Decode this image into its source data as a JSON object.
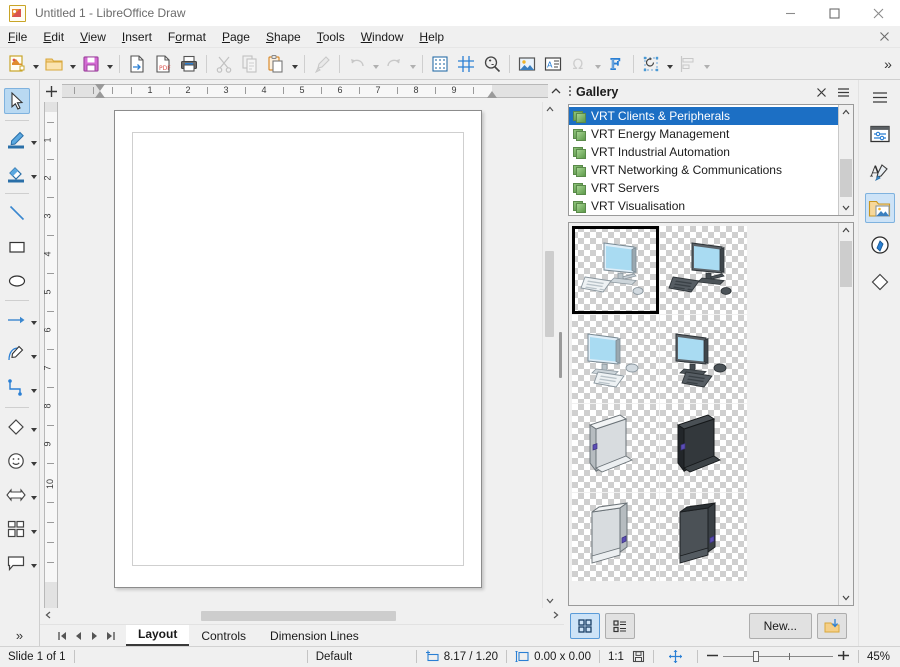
{
  "window": {
    "title": "Untitled 1 - LibreOffice Draw",
    "app_icon": "draw-document-icon",
    "minimize": "minimize-icon",
    "maximize": "maximize-icon",
    "close": "close-icon"
  },
  "menubar": {
    "items": [
      {
        "label": "File",
        "mnemonic": "F"
      },
      {
        "label": "Edit",
        "mnemonic": "E"
      },
      {
        "label": "View",
        "mnemonic": "V"
      },
      {
        "label": "Insert",
        "mnemonic": "I"
      },
      {
        "label": "Format",
        "mnemonic": "o"
      },
      {
        "label": "Page",
        "mnemonic": "P"
      },
      {
        "label": "Shape",
        "mnemonic": "S"
      },
      {
        "label": "Tools",
        "mnemonic": "T"
      },
      {
        "label": "Window",
        "mnemonic": "W"
      },
      {
        "label": "Help",
        "mnemonic": "H"
      }
    ],
    "document_close": "close-document-icon"
  },
  "toolbar": {
    "items": [
      {
        "name": "new-document",
        "label": "New",
        "icon": "new-document-icon",
        "dropdown": true,
        "disabled": false
      },
      {
        "name": "open-document",
        "label": "Open",
        "icon": "open-folder-icon",
        "dropdown": true,
        "disabled": false
      },
      {
        "name": "save-document",
        "label": "Save",
        "icon": "save-floppy-icon",
        "dropdown": true,
        "disabled": false
      },
      {
        "name": "export",
        "label": "Export",
        "icon": "export-icon",
        "dropdown": false,
        "disabled": false
      },
      {
        "name": "export-pdf",
        "label": "Export as PDF",
        "icon": "pdf-icon",
        "dropdown": false,
        "disabled": false
      },
      {
        "name": "print",
        "label": "Print",
        "icon": "printer-icon",
        "dropdown": false,
        "disabled": false
      },
      {
        "name": "cut",
        "label": "Cut",
        "icon": "scissors-icon",
        "dropdown": false,
        "disabled": true
      },
      {
        "name": "copy",
        "label": "Copy",
        "icon": "copy-icon",
        "dropdown": false,
        "disabled": true
      },
      {
        "name": "paste",
        "label": "Paste",
        "icon": "clipboard-paste-icon",
        "dropdown": true,
        "disabled": false
      },
      {
        "name": "clone-formatting",
        "label": "Clone Formatting",
        "icon": "paintbrush-clone-icon",
        "dropdown": false,
        "disabled": true
      },
      {
        "name": "undo",
        "label": "Undo",
        "icon": "undo-arrow-icon",
        "dropdown": true,
        "disabled": true
      },
      {
        "name": "redo",
        "label": "Redo",
        "icon": "redo-arrow-icon",
        "dropdown": true,
        "disabled": true
      },
      {
        "name": "display-grid",
        "label": "Display Grid",
        "icon": "grid-dots-icon",
        "dropdown": false,
        "disabled": false
      },
      {
        "name": "snap-to-grid",
        "label": "Snap to Grid",
        "icon": "snap-grid-icon",
        "dropdown": false,
        "disabled": false
      },
      {
        "name": "zoom",
        "label": "Zoom",
        "icon": "magnifier-zoom-icon",
        "dropdown": false,
        "disabled": false
      },
      {
        "name": "insert-image",
        "label": "Insert Image",
        "icon": "picture-icon",
        "dropdown": false,
        "disabled": false
      },
      {
        "name": "insert-text-box",
        "label": "Insert Text Box",
        "icon": "text-box-icon",
        "dropdown": false,
        "disabled": false
      },
      {
        "name": "special-character",
        "label": "Special Character",
        "icon": "omega-icon",
        "dropdown": true,
        "disabled": true
      },
      {
        "name": "fontwork",
        "label": "Fontwork",
        "icon": "fontwork-f-icon",
        "dropdown": false,
        "disabled": false
      },
      {
        "name": "transformations",
        "label": "Transformations",
        "icon": "rotate-object-icon",
        "dropdown": true,
        "disabled": false
      },
      {
        "name": "align-objects",
        "label": "Align Objects",
        "icon": "align-left-objects-icon",
        "dropdown": true,
        "disabled": true
      }
    ],
    "overflow": "toolbar-overflow-icon"
  },
  "left_tools": {
    "items": [
      {
        "name": "select",
        "label": "Select",
        "icon": "cursor-arrow-icon",
        "dropdown": false,
        "active": true
      },
      {
        "name": "line-color",
        "label": "Line Color",
        "icon": "line-color-icon",
        "dropdown": true,
        "active": false
      },
      {
        "name": "fill-color",
        "label": "Fill Color",
        "icon": "fill-color-icon",
        "dropdown": true,
        "active": false
      },
      {
        "name": "insert-line",
        "label": "Insert Line",
        "icon": "diagonal-line-icon",
        "dropdown": false,
        "active": false
      },
      {
        "name": "rectangle",
        "label": "Rectangle",
        "icon": "rectangle-icon",
        "dropdown": false,
        "active": false
      },
      {
        "name": "ellipse",
        "label": "Ellipse",
        "icon": "ellipse-icon",
        "dropdown": false,
        "active": false
      },
      {
        "name": "lines-arrows",
        "label": "Lines and Arrows",
        "icon": "arrow-line-icon",
        "dropdown": true,
        "active": false
      },
      {
        "name": "curves-polygons",
        "label": "Curves and Polygons",
        "icon": "curve-pen-icon",
        "dropdown": true,
        "active": false
      },
      {
        "name": "connectors",
        "label": "Connectors",
        "icon": "connector-icon",
        "dropdown": true,
        "active": false
      },
      {
        "name": "basic-shapes",
        "label": "Basic Shapes",
        "icon": "diamond-shape-icon",
        "dropdown": true,
        "active": false
      },
      {
        "name": "symbol-shapes",
        "label": "Symbol Shapes",
        "icon": "smiley-face-icon",
        "dropdown": true,
        "active": false
      },
      {
        "name": "block-arrows",
        "label": "Block Arrows",
        "icon": "double-arrow-icon",
        "dropdown": true,
        "active": false
      },
      {
        "name": "flowchart",
        "label": "Flowchart",
        "icon": "flowchart-grid-icon",
        "dropdown": true,
        "active": false
      },
      {
        "name": "callouts",
        "label": "Callout Shapes",
        "icon": "speech-bubble-icon",
        "dropdown": true,
        "active": false
      }
    ],
    "overflow": "left-toolbar-overflow-icon"
  },
  "rulers": {
    "horizontal": {
      "unit": "inch",
      "numbers": [
        1,
        2,
        3,
        4,
        5,
        6,
        7,
        8,
        9
      ],
      "corner_icon": "ruler-origin-icon",
      "collapse_icon": "chevron-up-icon"
    },
    "vertical": {
      "unit": "inch",
      "numbers": [
        1,
        2,
        3,
        4,
        5,
        6,
        7,
        8,
        9,
        10
      ]
    }
  },
  "canvas": {
    "page_name": "blank-drawing-page",
    "vscrollbar": "vertical-scrollbar",
    "hscrollbar": "horizontal-scrollbar"
  },
  "layer_tabs": {
    "nav": [
      {
        "name": "first-page",
        "icon": "first-page-icon"
      },
      {
        "name": "previous-page",
        "icon": "previous-page-icon"
      },
      {
        "name": "next-page",
        "icon": "next-page-icon"
      },
      {
        "name": "last-page",
        "icon": "last-page-icon"
      }
    ],
    "tabs": [
      {
        "label": "Layout",
        "active": true
      },
      {
        "label": "Controls",
        "active": false
      },
      {
        "label": "Dimension Lines",
        "active": false
      }
    ]
  },
  "gallery": {
    "title": "Gallery",
    "close_icon": "close-icon",
    "menu_icon": "hamburger-menu-icon",
    "grip_icon": "panel-grip-icon",
    "themes": [
      {
        "label": "VRT Clients & Peripherals",
        "selected": true
      },
      {
        "label": "VRT Energy Management",
        "selected": false
      },
      {
        "label": "VRT Industrial Automation",
        "selected": false
      },
      {
        "label": "VRT Networking & Communications",
        "selected": false
      },
      {
        "label": "VRT Servers",
        "selected": false
      },
      {
        "label": "VRT Visualisation",
        "selected": false
      }
    ],
    "theme_scroll_up": "scroll-up-icon",
    "theme_scroll_down": "scroll-down-icon",
    "thumbnails": [
      {
        "name": "desktop-computer-light-1",
        "kind": "desktop",
        "tone": "light",
        "selected": true
      },
      {
        "name": "desktop-computer-dark-1",
        "kind": "desktop",
        "tone": "dark",
        "selected": false
      },
      {
        "name": "blank-cell-1",
        "kind": "blank",
        "tone": "none",
        "selected": false
      },
      {
        "name": "desktop-computer-light-2",
        "kind": "desktop",
        "tone": "light",
        "selected": false
      },
      {
        "name": "desktop-computer-dark-2",
        "kind": "desktop",
        "tone": "dark",
        "selected": false
      },
      {
        "name": "blank-cell-2",
        "kind": "blank",
        "tone": "none",
        "selected": false
      },
      {
        "name": "pc-tower-light-1",
        "kind": "tower",
        "tone": "light",
        "selected": false
      },
      {
        "name": "pc-tower-dark-1",
        "kind": "tower",
        "tone": "dark",
        "selected": false
      },
      {
        "name": "blank-cell-3",
        "kind": "blank",
        "tone": "none",
        "selected": false
      },
      {
        "name": "pc-tower-light-2",
        "kind": "tower",
        "tone": "light",
        "selected": false
      },
      {
        "name": "pc-tower-dark-2",
        "kind": "tower",
        "tone": "dark",
        "selected": false
      },
      {
        "name": "blank-cell-4",
        "kind": "blank",
        "tone": "none",
        "selected": false
      }
    ],
    "footer": {
      "icon_view": {
        "label": "",
        "icon": "icon-view-icon",
        "active": true
      },
      "list_view": {
        "label": "",
        "icon": "list-view-icon",
        "active": false
      },
      "new_button": "New...",
      "insert_button_icon": "insert-object-icon"
    }
  },
  "sidebar_rail": {
    "items": [
      {
        "name": "sidebar-settings",
        "label": "Sidebar Settings",
        "icon": "hamburger-menu-icon",
        "active": false
      },
      {
        "name": "properties",
        "label": "Properties",
        "icon": "properties-panel-icon",
        "active": false
      },
      {
        "name": "styles",
        "label": "Styles",
        "icon": "styles-brush-icon",
        "active": false
      },
      {
        "name": "gallery",
        "label": "Gallery",
        "icon": "gallery-folder-icon",
        "active": true
      },
      {
        "name": "navigator",
        "label": "Navigator",
        "icon": "compass-icon",
        "active": false
      },
      {
        "name": "shapes",
        "label": "Shapes",
        "icon": "diamond-shape-icon",
        "active": false
      }
    ]
  },
  "statusbar": {
    "slide_info": "Slide 1 of 1",
    "page_style": "Default",
    "cursor_position": "8.17 / 1.20",
    "cursor_icon": "cursor-position-icon",
    "object_size": "0.00 x 0.00",
    "size_icon": "object-size-icon",
    "scale": "1:1",
    "save_status_icon": "unsaved-changes-icon",
    "fit_slide_icon": "fit-slide-icon",
    "zoom_out_icon": "minus-icon",
    "zoom_in_icon": "plus-icon",
    "zoom_level": "45%"
  }
}
